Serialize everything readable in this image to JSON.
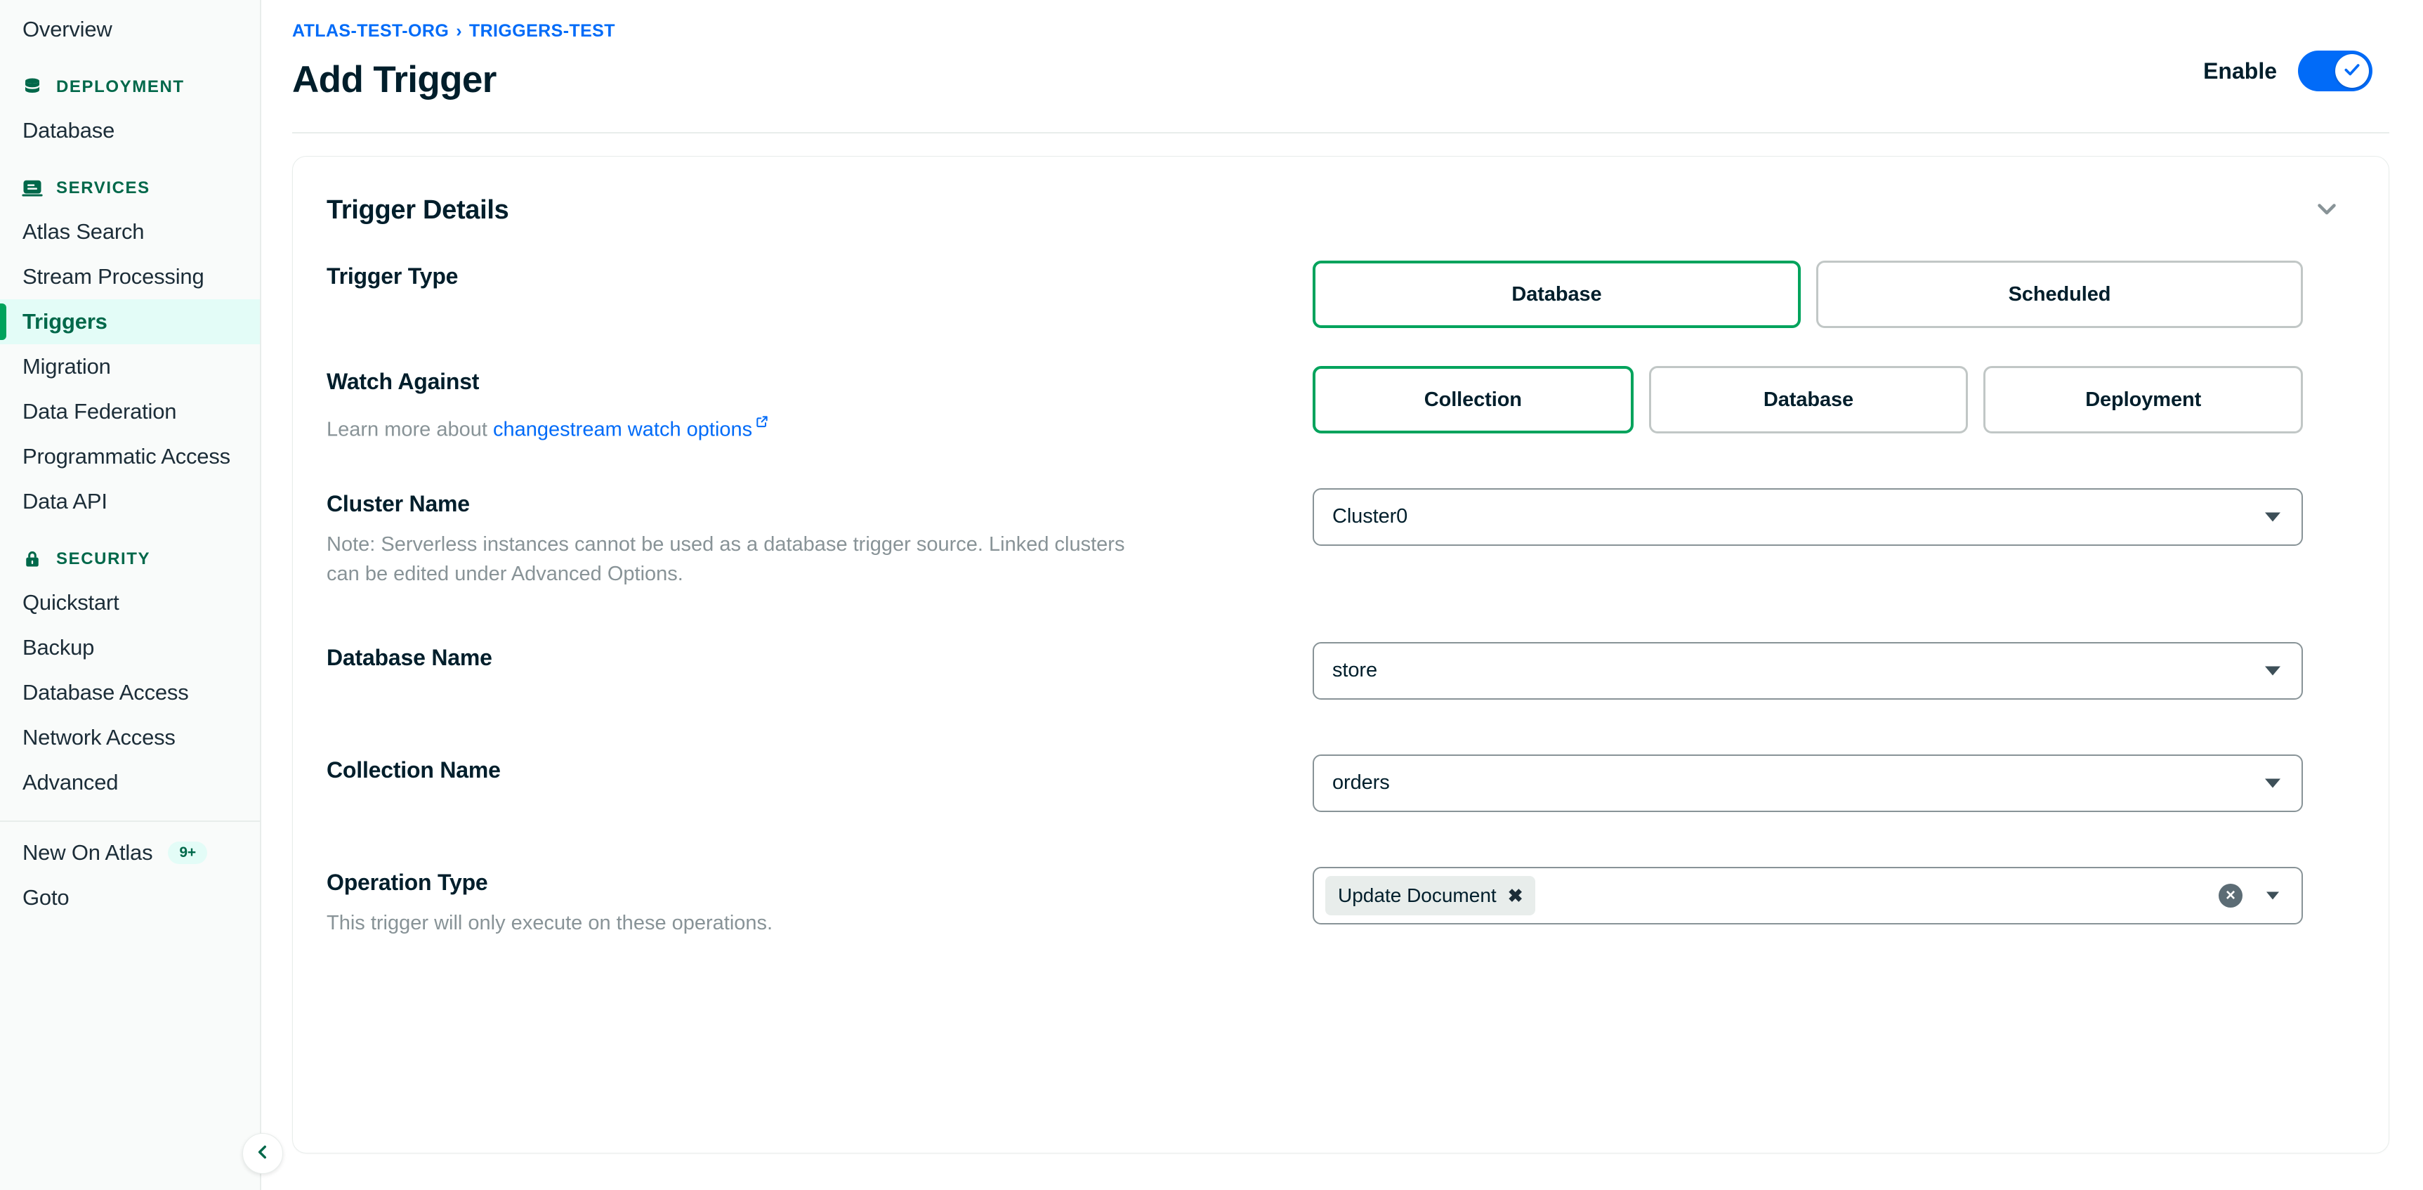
{
  "sidebar": {
    "top_items": [
      {
        "label": "Overview",
        "name": "sidebar-item-overview",
        "active": false
      }
    ],
    "sections": [
      {
        "title": "DEPLOYMENT",
        "icon": "database-icon",
        "items": [
          {
            "label": "Database",
            "name": "sidebar-item-database",
            "active": false
          }
        ]
      },
      {
        "title": "SERVICES",
        "icon": "services-icon",
        "items": [
          {
            "label": "Atlas Search",
            "name": "sidebar-item-atlas-search",
            "active": false
          },
          {
            "label": "Stream Processing",
            "name": "sidebar-item-stream-processing",
            "active": false
          },
          {
            "label": "Triggers",
            "name": "sidebar-item-triggers",
            "active": true
          },
          {
            "label": "Migration",
            "name": "sidebar-item-migration",
            "active": false
          },
          {
            "label": "Data Federation",
            "name": "sidebar-item-data-federation",
            "active": false
          },
          {
            "label": "Programmatic Access",
            "name": "sidebar-item-programmatic-access",
            "active": false
          },
          {
            "label": "Data API",
            "name": "sidebar-item-data-api",
            "active": false
          }
        ]
      },
      {
        "title": "SECURITY",
        "icon": "lock-icon",
        "items": [
          {
            "label": "Quickstart",
            "name": "sidebar-item-quickstart",
            "active": false
          },
          {
            "label": "Backup",
            "name": "sidebar-item-backup",
            "active": false
          },
          {
            "label": "Database Access",
            "name": "sidebar-item-database-access",
            "active": false
          },
          {
            "label": "Network Access",
            "name": "sidebar-item-network-access",
            "active": false
          },
          {
            "label": "Advanced",
            "name": "sidebar-item-advanced",
            "active": false
          }
        ]
      }
    ],
    "footer_items": [
      {
        "label": "New On Atlas",
        "name": "sidebar-item-new-on-atlas",
        "badge": "9+"
      },
      {
        "label": "Goto",
        "name": "sidebar-item-goto",
        "badge": ""
      }
    ],
    "collapse_icon": "chevron-left-icon"
  },
  "header": {
    "breadcrumb": {
      "org": "ATLAS-TEST-ORG",
      "separator": "›",
      "project": "TRIGGERS-TEST"
    },
    "title": "Add Trigger",
    "enable_label": "Enable",
    "enable_on": true
  },
  "panel": {
    "title": "Trigger Details",
    "collapse_icon": "chevron-down-icon"
  },
  "form": {
    "trigger_type": {
      "label": "Trigger Type",
      "options": [
        "Database",
        "Scheduled"
      ],
      "selected": "Database"
    },
    "watch_against": {
      "label": "Watch Against",
      "help_prefix": "Learn more about ",
      "help_link": "changestream watch options",
      "options": [
        "Collection",
        "Database",
        "Deployment"
      ],
      "selected": "Collection"
    },
    "cluster_name": {
      "label": "Cluster Name",
      "help": "Note: Serverless instances cannot be used as a database trigger source. Linked clusters can be edited under Advanced Options.",
      "value": "Cluster0"
    },
    "database_name": {
      "label": "Database Name",
      "value": "store"
    },
    "collection_name": {
      "label": "Collection Name",
      "value": "orders"
    },
    "operation_type": {
      "label": "Operation Type",
      "help": "This trigger will only execute on these operations.",
      "chips": [
        "Update Document"
      ],
      "chip_remove_glyph": "✖",
      "clear_all_glyph": "×"
    }
  },
  "colors": {
    "brand_green": "#00684A",
    "accent_green": "#00A35C",
    "link_blue": "#016BF8",
    "toggle_blue": "#016BF8",
    "text_dark": "#001E2B",
    "text_muted": "#889397",
    "panel_border": "#E8EDEB",
    "sidebar_bg": "#F9FBFA",
    "active_bg": "#E3FCF7"
  }
}
